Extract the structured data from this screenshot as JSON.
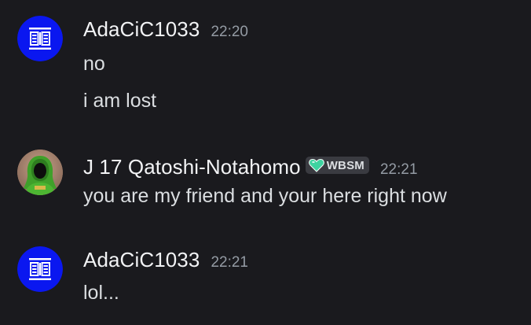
{
  "messages": [
    {
      "author": "AdaCiC1033",
      "time": "22:20",
      "avatar_icon": "server-logo-icon",
      "avatar_color": "#0a17f0",
      "lines": [
        "no",
        "i am lost"
      ]
    },
    {
      "author": "J 17 Qatoshi-Notahomo",
      "time": "22:21",
      "avatar_icon": "green-hooded-figure-icon",
      "tag": {
        "icon": "green-heart-icon",
        "label": "WBSM",
        "color": "#3ed3a0"
      },
      "lines": [
        "you are my friend and your here right now"
      ]
    },
    {
      "author": "AdaCiC1033",
      "time": "22:21",
      "avatar_icon": "server-logo-icon",
      "avatar_color": "#0a17f0",
      "lines": [
        "lol..."
      ]
    }
  ]
}
